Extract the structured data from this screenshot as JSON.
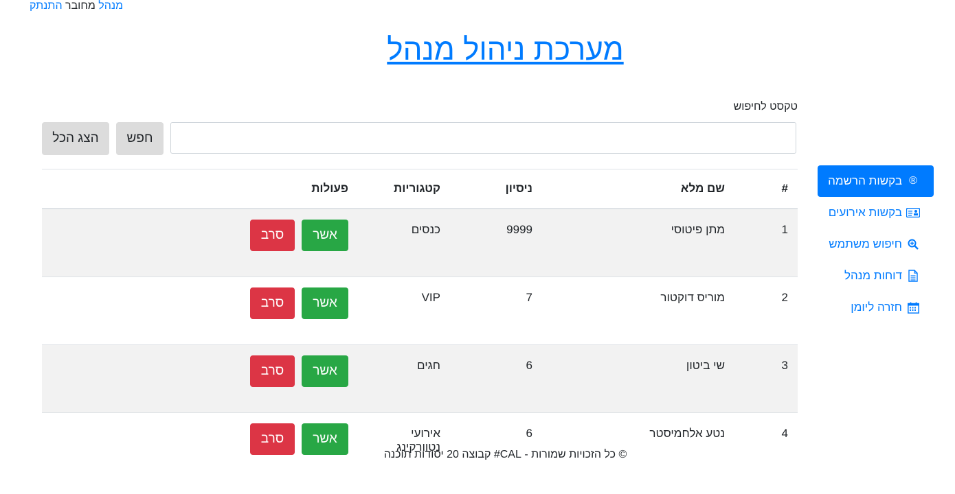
{
  "topbar": {
    "user": "מנהל",
    "status": "מחובר",
    "logout": "התנתק"
  },
  "title": "מערכת ניהול מנהל",
  "search": {
    "label": "טקסט לחיפוש",
    "placeholder": "",
    "search_button": "חפש",
    "show_all_button": "הצג הכל"
  },
  "table": {
    "headers": [
      "#",
      "שם מלא",
      "ניסיון",
      "קטגוריות",
      "פעולות"
    ],
    "rows": [
      {
        "num": "1",
        "name": "מתן פיטוסי",
        "experience": "9999",
        "categories": "כנסים"
      },
      {
        "num": "2",
        "name": "מוריס דוקטור",
        "experience": "7",
        "categories": "VIP"
      },
      {
        "num": "3",
        "name": "שי ביטון",
        "experience": "6",
        "categories": "חגים"
      },
      {
        "num": "4",
        "name": "נטע אלחמיסטר",
        "experience": "6",
        "categories": "אירועי נטוורקינג"
      }
    ],
    "approve_label": "אשר",
    "reject_label": "סרב"
  },
  "sidebar": {
    "items": [
      {
        "label": "בקשות הרשמה",
        "icon": "registered-icon",
        "active": true
      },
      {
        "label": "בקשות אירועים",
        "icon": "id-card-icon",
        "active": false
      },
      {
        "label": "חיפוש משתמש",
        "icon": "search-plus-icon",
        "active": false
      },
      {
        "label": "דוחות מנהל",
        "icon": "file-icon",
        "active": false
      },
      {
        "label": "חזרה ליומן",
        "icon": "calendar-icon",
        "active": false
      }
    ]
  },
  "footer": "© כל הזכויות שמורות - CAL# קבוצה 20 יסודות תוכנה",
  "colors": {
    "primary": "#007bff",
    "success": "#28a745",
    "danger": "#dc3545",
    "gray_button": "#dcdcdc"
  }
}
